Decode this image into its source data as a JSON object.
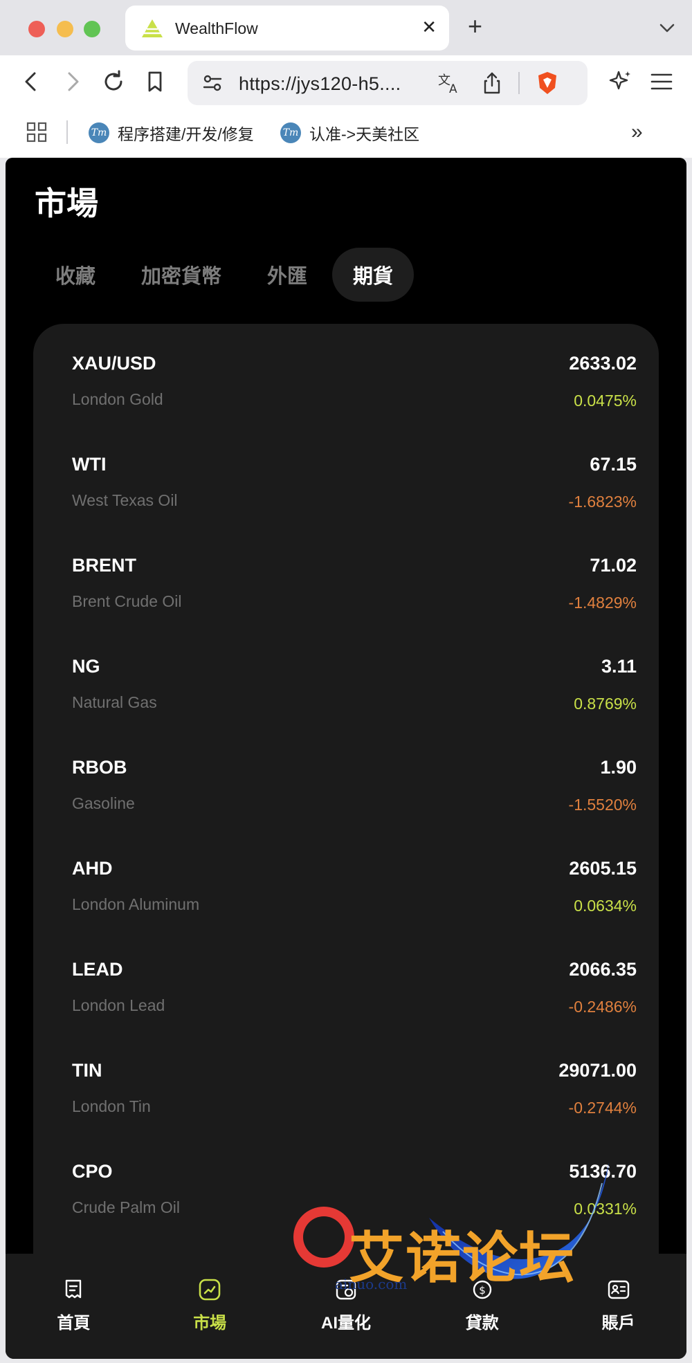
{
  "browser": {
    "tab_title": "WealthFlow",
    "url": "https://jys120-h5....",
    "bookmarks": [
      {
        "label": "程序搭建/开发/修复",
        "favicon": "Tm"
      },
      {
        "label": "认准->天美社区",
        "favicon": "Tm"
      }
    ],
    "icons": [
      "back-icon",
      "forward-icon",
      "reload-icon",
      "bookmark-icon",
      "site-settings-icon",
      "translate-icon",
      "share-icon",
      "brave-shield-icon",
      "ai-sparkle-icon",
      "menu-icon"
    ]
  },
  "app": {
    "title": "市場",
    "tabs": [
      {
        "label": "收藏",
        "active": false
      },
      {
        "label": "加密貨幣",
        "active": false
      },
      {
        "label": "外匯",
        "active": false
      },
      {
        "label": "期貨",
        "active": true
      }
    ],
    "markets": [
      {
        "symbol": "XAU/USD",
        "name": "London Gold",
        "price": "2633.02",
        "change": "0.0475%",
        "direction": "up"
      },
      {
        "symbol": "WTI",
        "name": "West Texas Oil",
        "price": "67.15",
        "change": "-1.6823%",
        "direction": "down"
      },
      {
        "symbol": "BRENT",
        "name": "Brent Crude Oil",
        "price": "71.02",
        "change": "-1.4829%",
        "direction": "down"
      },
      {
        "symbol": "NG",
        "name": "Natural Gas",
        "price": "3.11",
        "change": "0.8769%",
        "direction": "up"
      },
      {
        "symbol": "RBOB",
        "name": "Gasoline",
        "price": "1.90",
        "change": "-1.5520%",
        "direction": "down"
      },
      {
        "symbol": "AHD",
        "name": "London Aluminum",
        "price": "2605.15",
        "change": "0.0634%",
        "direction": "up"
      },
      {
        "symbol": "LEAD",
        "name": "London Lead",
        "price": "2066.35",
        "change": "-0.2486%",
        "direction": "down"
      },
      {
        "symbol": "TIN",
        "name": "London Tin",
        "price": "29071.00",
        "change": "-0.2744%",
        "direction": "down"
      },
      {
        "symbol": "CPO",
        "name": "Crude Palm Oil",
        "price": "5136.70",
        "change": "0.0331%",
        "direction": "up"
      }
    ],
    "colors": {
      "up": "#c9e048",
      "down": "#e0803e",
      "accent": "#c9e048",
      "card": "#1b1b1b"
    },
    "nav": [
      {
        "label": "首頁",
        "icon": "home-icon",
        "active": false
      },
      {
        "label": "市場",
        "icon": "market-chart-icon",
        "active": true
      },
      {
        "label": "AI量化",
        "icon": "ai-quant-icon",
        "active": false
      },
      {
        "label": "貸款",
        "icon": "loan-coin-icon",
        "active": false
      },
      {
        "label": "賬戶",
        "icon": "account-card-icon",
        "active": false
      }
    ]
  },
  "watermark": {
    "text": "艾诺论坛",
    "subtext": "ainuo.com"
  }
}
